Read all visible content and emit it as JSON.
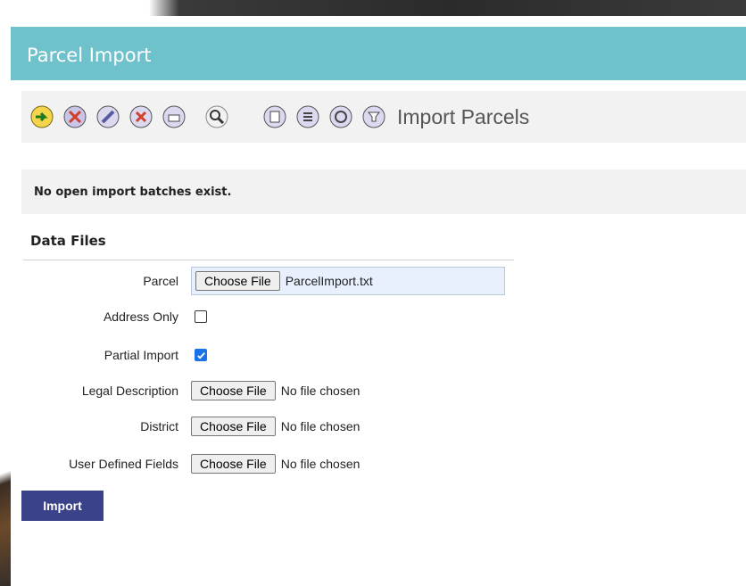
{
  "window": {
    "title": "Parcel Import"
  },
  "toolbar": {
    "title": "Import Parcels",
    "icons": [
      "import-icon",
      "cancel-icon",
      "edit-icon",
      "delete-icon",
      "print-icon",
      "search-icon",
      "report-icon",
      "list-icon",
      "refresh-icon",
      "filter-icon"
    ]
  },
  "message": "No open import batches exist.",
  "data_files": {
    "section_title": "Data Files",
    "parcel": {
      "label": "Parcel",
      "button": "Choose File",
      "file": "ParcelImport.txt"
    },
    "address_only": {
      "label": "Address Only",
      "checked": false
    },
    "partial_import": {
      "label": "Partial Import",
      "checked": true
    },
    "legal_description": {
      "label": "Legal Description",
      "button": "Choose File",
      "file": "No file chosen"
    },
    "district": {
      "label": "District",
      "button": "Choose File",
      "file": "No file chosen"
    },
    "user_defined": {
      "label": "User Defined Fields",
      "button": "Choose File",
      "file": "No file chosen"
    }
  },
  "import_button": "Import"
}
